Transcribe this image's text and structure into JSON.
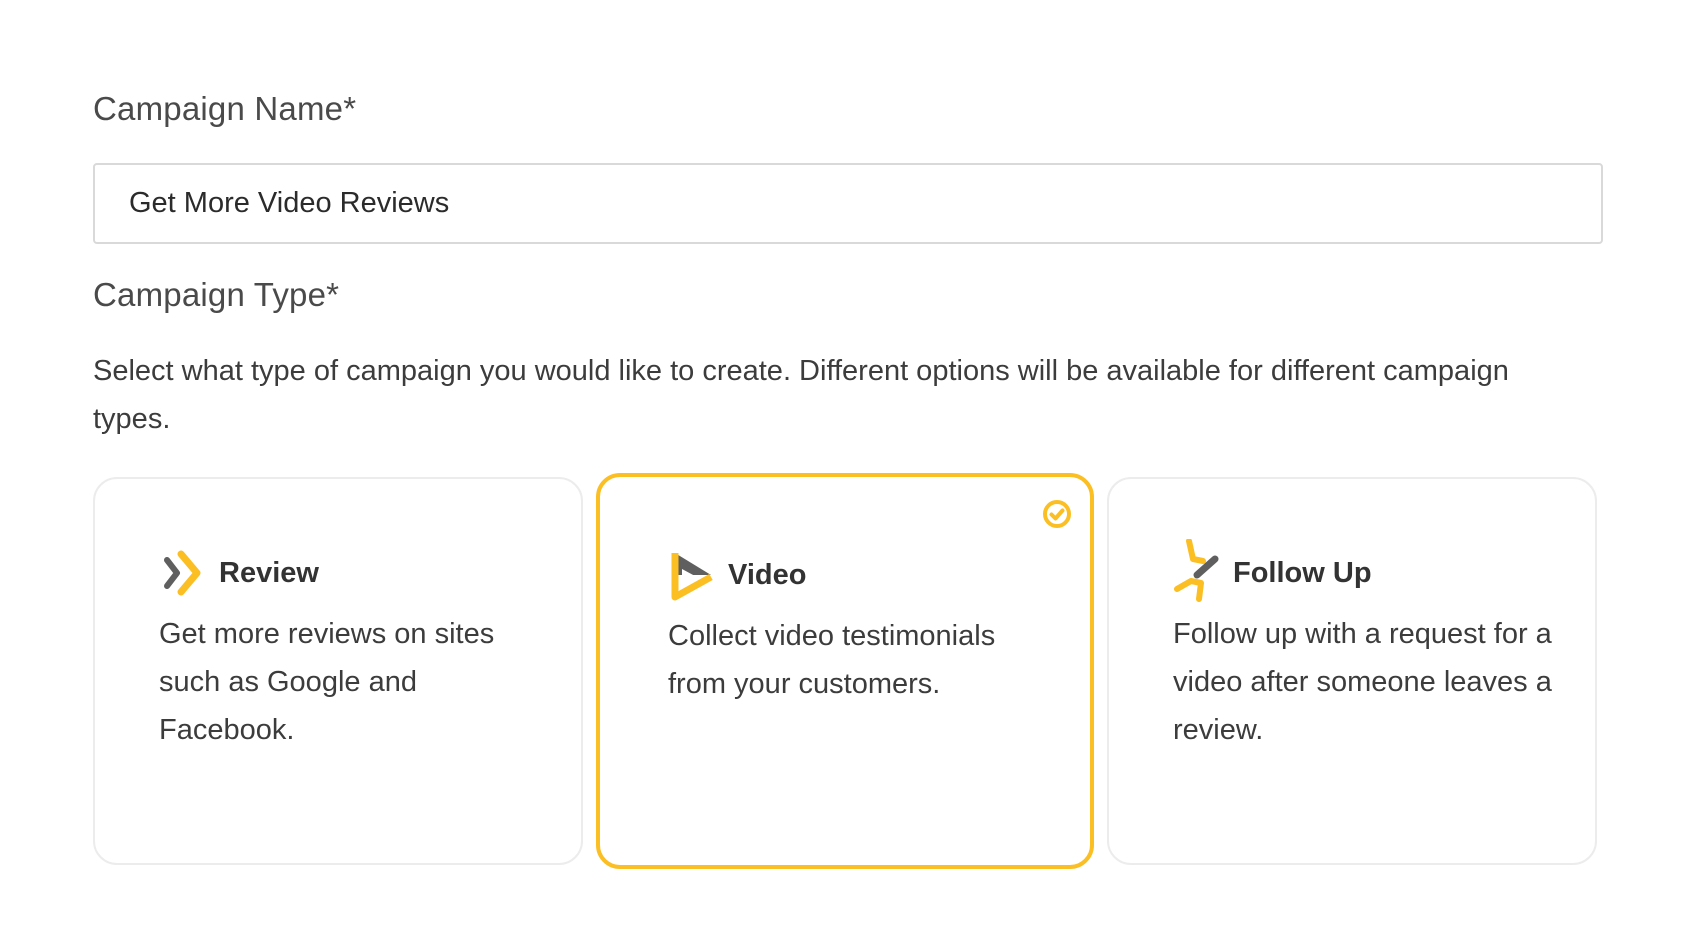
{
  "campaign_name": {
    "label": "Campaign Name*",
    "value": "Get More Video Reviews"
  },
  "campaign_type": {
    "label": "Campaign Type*",
    "help": "Select what type of campaign you would like to create. Different options will be available for different campaign types.",
    "selected": "video",
    "options": [
      {
        "id": "review",
        "title": "Review",
        "description": "Get more reviews on sites such as Google and Facebook.",
        "icon": "chevron-arrow-icon"
      },
      {
        "id": "video",
        "title": "Video",
        "description": "Collect video testimonials from your customers.",
        "icon": "play-triangle-icon"
      },
      {
        "id": "followup",
        "title": "Follow Up",
        "description": "Follow up with a request for a video after someone leaves a review.",
        "icon": "follow-up-star-icon"
      }
    ]
  },
  "colors": {
    "accent": "#fbbf24",
    "icon_dark": "#5f5f5f",
    "border": "#ececec"
  }
}
